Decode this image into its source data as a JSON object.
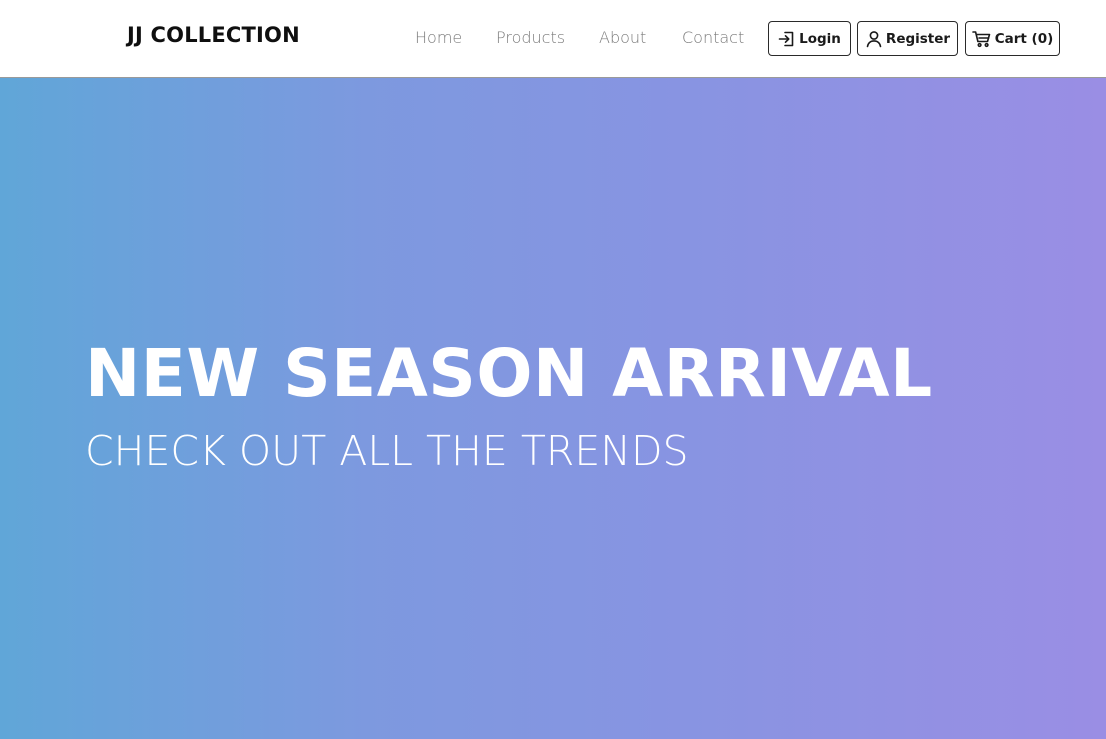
{
  "brand": {
    "name": "JJ COLLECTION"
  },
  "nav": {
    "links": [
      {
        "label": "Home"
      },
      {
        "label": "Products"
      },
      {
        "label": "About"
      },
      {
        "label": "Contact"
      }
    ]
  },
  "actions": {
    "login": {
      "label": "Login",
      "icon": "login-icon"
    },
    "register": {
      "label": "Register",
      "icon": "user-icon"
    },
    "cart": {
      "label": "Cart (0)",
      "icon": "cart-icon"
    }
  },
  "hero": {
    "title": "NEW SEASON ARRIVAL",
    "subtitle": "CHECK OUT ALL THE TRENDS",
    "gradient_start": "#60a6d8",
    "gradient_end": "#9a8ee4"
  },
  "colors": {
    "nav_link": "#7b7b7b",
    "brand_text": "#0f0f0f",
    "hero_text": "#ffffff"
  }
}
